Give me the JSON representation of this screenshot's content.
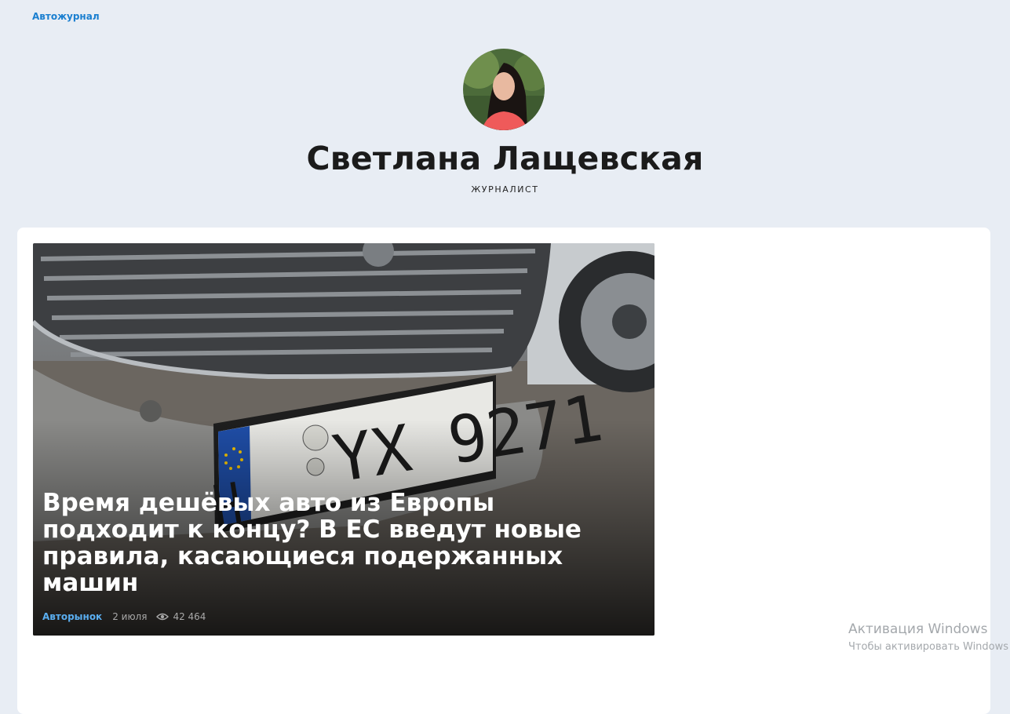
{
  "breadcrumb": {
    "label": "Автожурнал"
  },
  "author": {
    "name": "Светлана Лащевская",
    "role": "ЖУРНАЛИСТ"
  },
  "article": {
    "title": "Время дешёвых авто из Европы подходит к концу? В ЕС введут новые правила, касающиеся подержанных машин",
    "category": "Авторынок",
    "date": "2 июля",
    "views": "42 464",
    "plate_text": "H YX 9271",
    "views_icon": "eye-icon"
  },
  "os_watermark": {
    "title": "Активация Windows",
    "subtitle": "Чтобы активировать Windows"
  },
  "colors": {
    "background": "#e8edf4",
    "link": "#1a7fd0",
    "category": "#5aaef0",
    "card": "#ffffff"
  }
}
